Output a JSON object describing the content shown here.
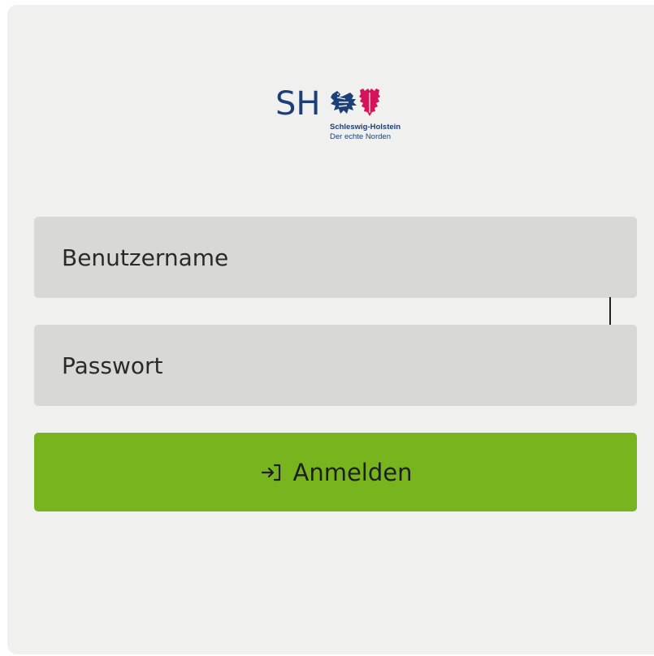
{
  "logo": {
    "mark": "SH",
    "name_line": "Schleswig-Holstein",
    "slogan_line": "Der echte Norden",
    "icons": [
      "lion-icon",
      "nettle-leaf-icon"
    ],
    "colors": {
      "navy": "#1c3f78",
      "red": "#d4145a"
    }
  },
  "form": {
    "username": {
      "placeholder": "Benutzername",
      "value": ""
    },
    "password": {
      "placeholder": "Passwort",
      "value": ""
    },
    "submit": {
      "label": "Anmelden",
      "icon": "login-icon"
    }
  },
  "colors": {
    "card_background": "#f0f0ef",
    "field_background": "#d8d8d7",
    "button_background": "#78b41e"
  }
}
